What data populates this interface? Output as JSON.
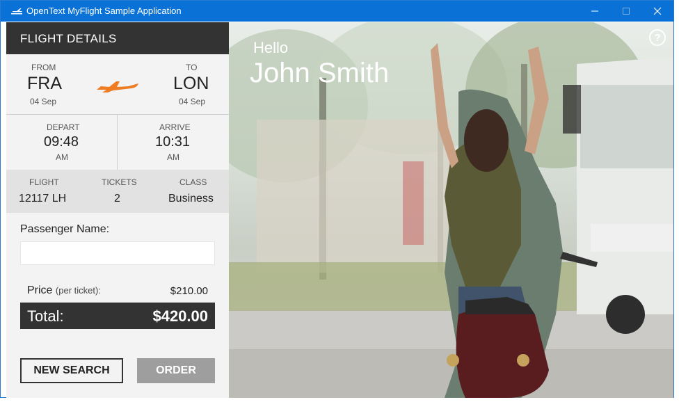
{
  "window": {
    "title": "OpenText MyFlight Sample Application",
    "icon": "plane-icon",
    "controls": [
      "minimize-icon",
      "maximize-icon",
      "close-icon"
    ]
  },
  "panel": {
    "header": "FLIGHT DETAILS",
    "route": {
      "from_label": "FROM",
      "from_code": "FRA",
      "from_date": "04 Sep",
      "to_label": "TO",
      "to_code": "LON",
      "to_date": "04 Sep",
      "icon": "airplane-icon"
    },
    "times": {
      "depart_label": "DEPART",
      "depart_time": "09:48",
      "depart_ampm": "AM",
      "arrive_label": "ARRIVE",
      "arrive_time": "10:31",
      "arrive_ampm": "AM"
    },
    "info": {
      "flight_label": "FLIGHT",
      "flight_value": "12117 LH",
      "tickets_label": "TICKETS",
      "tickets_value": "2",
      "class_label": "CLASS",
      "class_value": "Business"
    },
    "passenger": {
      "label": "Passenger Name:",
      "value": "",
      "placeholder": ""
    },
    "price": {
      "label": "Price",
      "sub": "(per ticket):",
      "value": "$210.00"
    },
    "total": {
      "label": "Total:",
      "value": "$420.00"
    },
    "buttons": {
      "new_search": "NEW SEARCH",
      "order": "ORDER"
    }
  },
  "photo": {
    "greeting": "Hello",
    "user_name": "John Smith",
    "help_icon": "?"
  },
  "colors": {
    "titlebar": "#0a72d6",
    "header": "#333333",
    "accent": "#f07c22",
    "order_button": "#9e9e9e"
  }
}
